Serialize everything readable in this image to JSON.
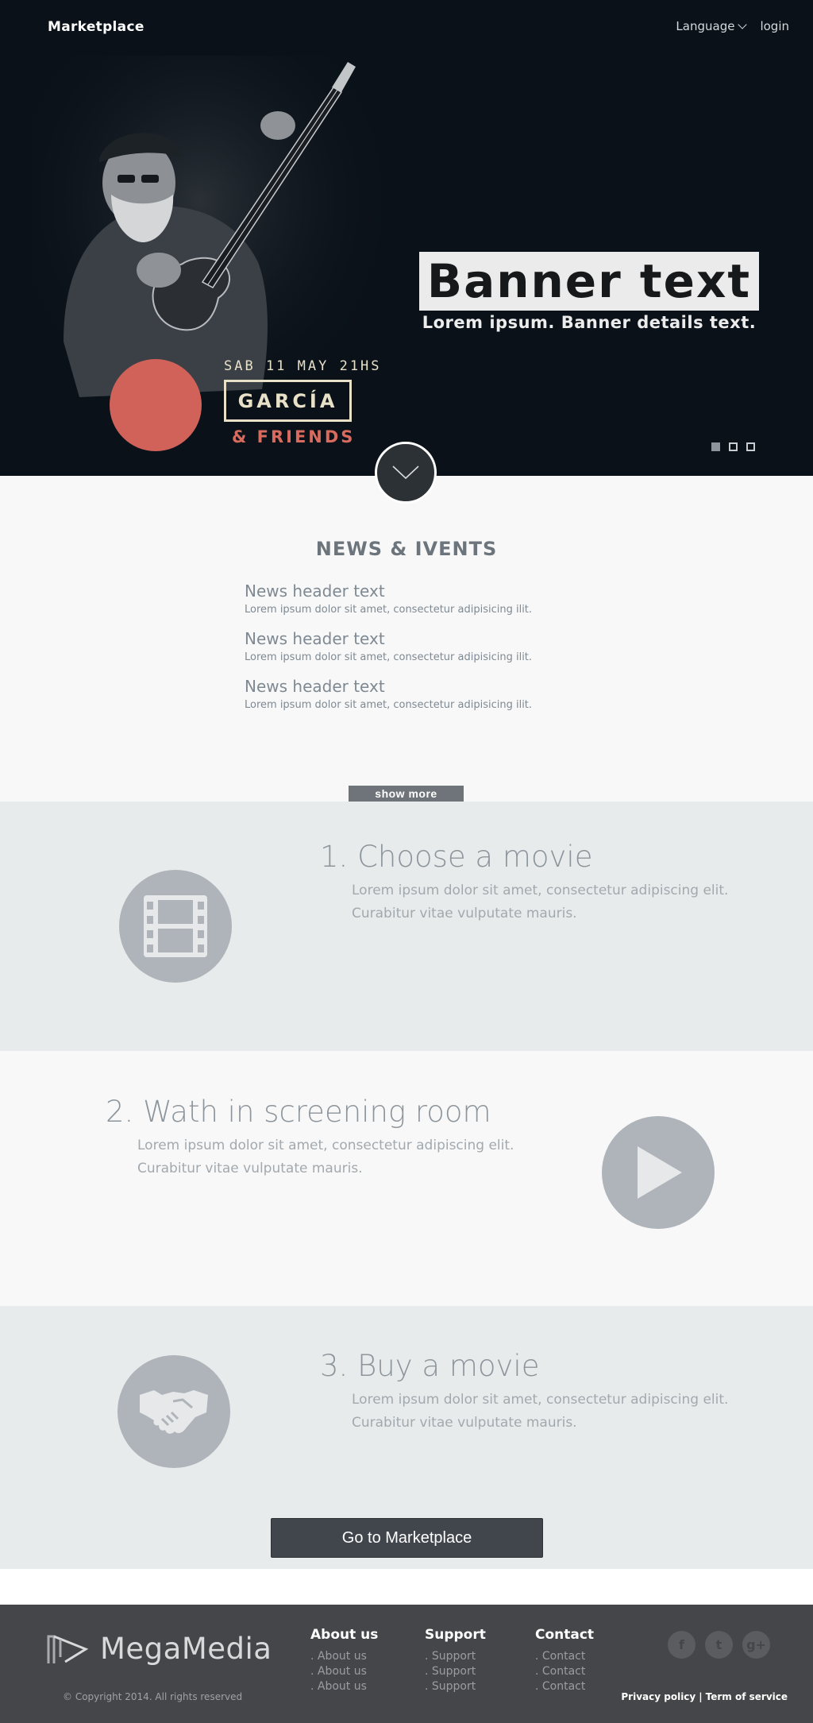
{
  "header": {
    "brand": "Marketplace",
    "language_label": "Language",
    "login_label": "login"
  },
  "hero": {
    "event_date": "SAB 11 MAY 21HS",
    "event_name": "GARCÍA",
    "event_friends": "& FRIENDS",
    "banner_title": "Banner text",
    "banner_subtitle": "Lorem ipsum. Banner details text.",
    "slides": 3,
    "active_slide": 1
  },
  "news": {
    "title": "NEWS & IVENTS",
    "items": [
      {
        "header": "News header text",
        "text": "Lorem ipsum dolor sit amet, consectetur adipisicing ilit."
      },
      {
        "header": "News header text",
        "text": "Lorem ipsum dolor sit amet, consectetur adipisicing ilit."
      },
      {
        "header": "News header text",
        "text": "Lorem ipsum dolor sit amet, consectetur adipisicing ilit."
      }
    ],
    "show_more_label": "show more"
  },
  "steps": [
    {
      "title": "1. Choose a movie",
      "line1": "Lorem ipsum dolor sit amet, consectetur adipiscing elit.",
      "line2": "Curabitur vitae vulputate mauris.",
      "icon": "film-icon"
    },
    {
      "title": "2. Wath in screening room",
      "line1": "Lorem ipsum dolor sit amet, consectetur adipiscing elit.",
      "line2": "Curabitur vitae vulputate mauris.",
      "icon": "play-icon"
    },
    {
      "title": "3. Buy a movie",
      "line1": "Lorem ipsum dolor sit amet, consectetur adipiscing elit.",
      "line2": "Curabitur vitae vulputate mauris.",
      "icon": "handshake-icon"
    }
  ],
  "cta": {
    "label": "Go to Marketplace"
  },
  "footer": {
    "logo_text": "MegaMedia",
    "copyright": "© Copyright 2014. All rights reserved",
    "columns": [
      {
        "title": "About us",
        "links": [
          ". About us",
          ". About us",
          ". About us"
        ]
      },
      {
        "title": "Support",
        "links": [
          ". Support",
          ". Support",
          ". Support"
        ]
      },
      {
        "title": "Contact",
        "links": [
          ". Contact",
          ". Contact",
          ". Contact"
        ]
      }
    ],
    "social": [
      {
        "icon": "facebook-icon",
        "glyph": "f"
      },
      {
        "icon": "twitter-icon",
        "glyph": "t"
      },
      {
        "icon": "google-plus-icon",
        "glyph": "g+"
      }
    ],
    "privacy_label": "Privacy policy",
    "separator": "|",
    "terms_label": "Term of service"
  },
  "colors": {
    "hero_bg": "#0a1119",
    "accent_red": "#d1625a",
    "event_cream": "#e8e1c8",
    "footer_bg": "#454649",
    "cta_bg": "#41464c",
    "step_icon_bg": "#aeb4b9"
  }
}
